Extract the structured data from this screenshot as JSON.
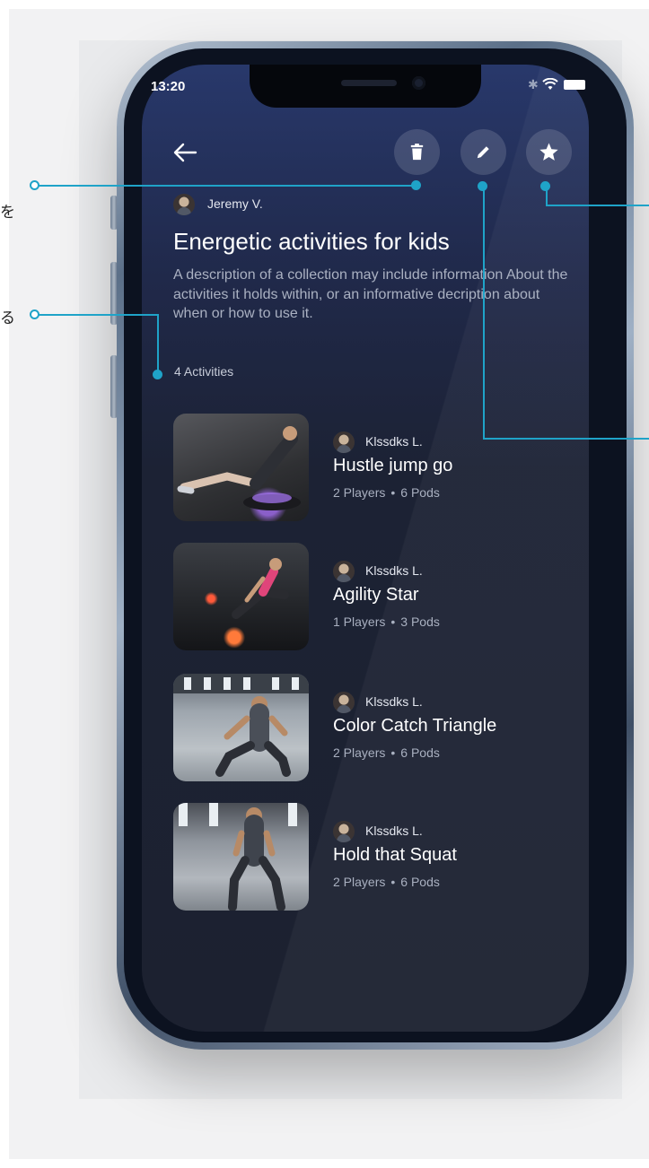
{
  "status_bar": {
    "time": "13:20"
  },
  "edge_annotations": {
    "left_top": "を",
    "left_middle": "る"
  },
  "toolbar": {
    "back_icon": "arrow-left-icon",
    "delete_icon": "trash-icon",
    "edit_icon": "pencil-icon",
    "favorite_icon": "star-icon"
  },
  "collection": {
    "author": "Jeremy V.",
    "title": "Energetic activities for kids",
    "description": "A description of a collection may include information About the activities it holds within, or an informative decription about when or how to use it.",
    "activity_count": "4 Activities"
  },
  "activities": [
    {
      "author": "Klssdks L.",
      "title": "Hustle jump go",
      "players": "2 Players",
      "pods": "6 Pods"
    },
    {
      "author": "Klssdks L.",
      "title": "Agility Star",
      "players": "1 Players",
      "pods": "3 Pods"
    },
    {
      "author": "Klssdks L.",
      "title": "Color Catch Triangle",
      "players": "2 Players",
      "pods": "6 Pods"
    },
    {
      "author": "Klssdks L.",
      "title": "Hold that Squat",
      "players": "2 Players",
      "pods": "6 Pods"
    }
  ],
  "colors": {
    "accent": "#1fa3c8",
    "screen_bg": "#1c2130",
    "header_bg": "#28386b"
  }
}
